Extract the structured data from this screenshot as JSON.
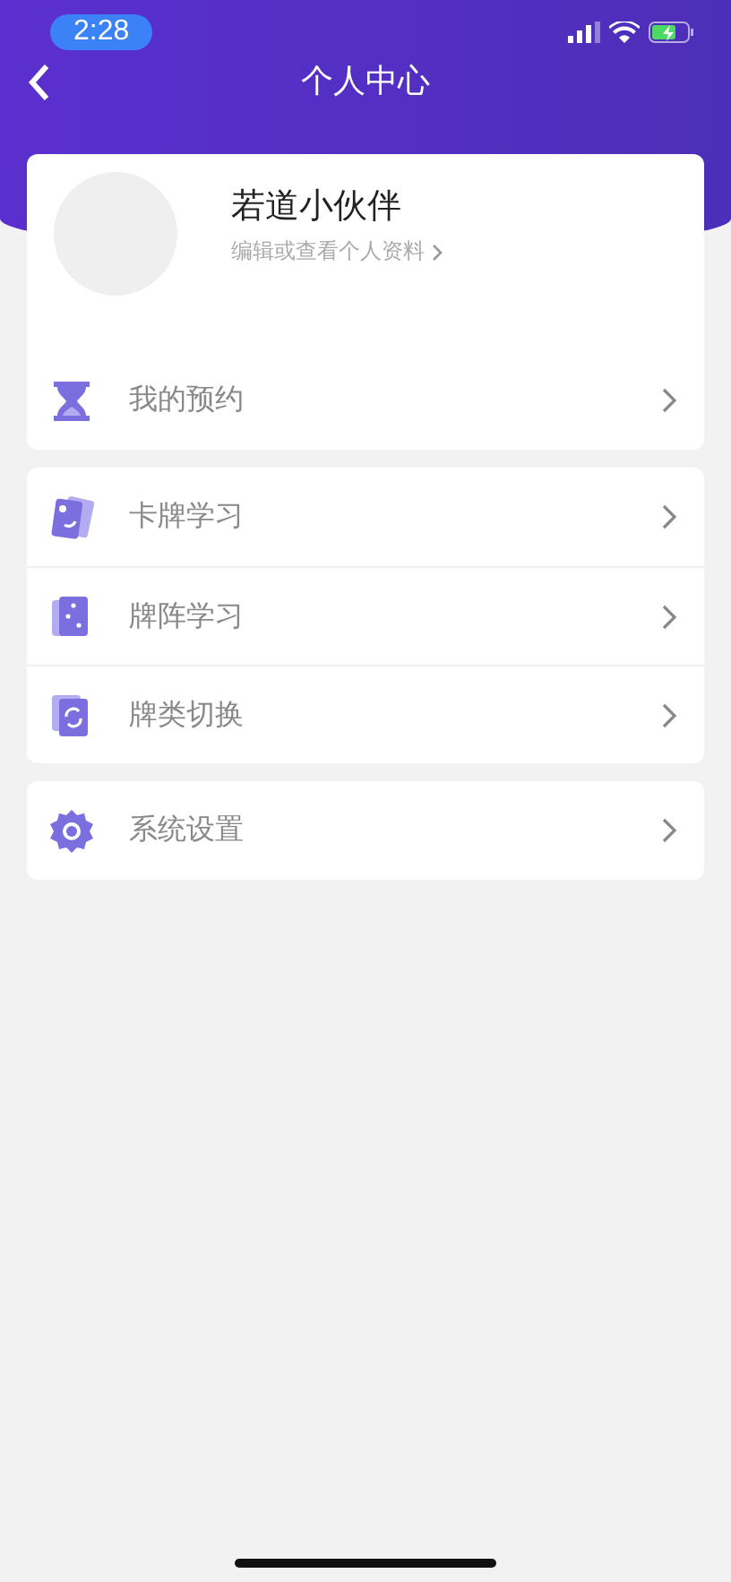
{
  "status_bar": {
    "time": "2:28"
  },
  "nav": {
    "title": "个人中心"
  },
  "profile": {
    "name": "若道小伙伴",
    "link": "编辑或查看个人资料"
  },
  "menu_groups": [
    [
      {
        "kind": "hourglass",
        "label": "我的预约"
      }
    ],
    [
      {
        "kind": "card-moon",
        "label": "卡牌学习"
      },
      {
        "kind": "card-stars",
        "label": "牌阵学习"
      },
      {
        "kind": "card-refresh",
        "label": "牌类切换"
      }
    ],
    [
      {
        "kind": "gear",
        "label": "系统设置"
      }
    ]
  ]
}
